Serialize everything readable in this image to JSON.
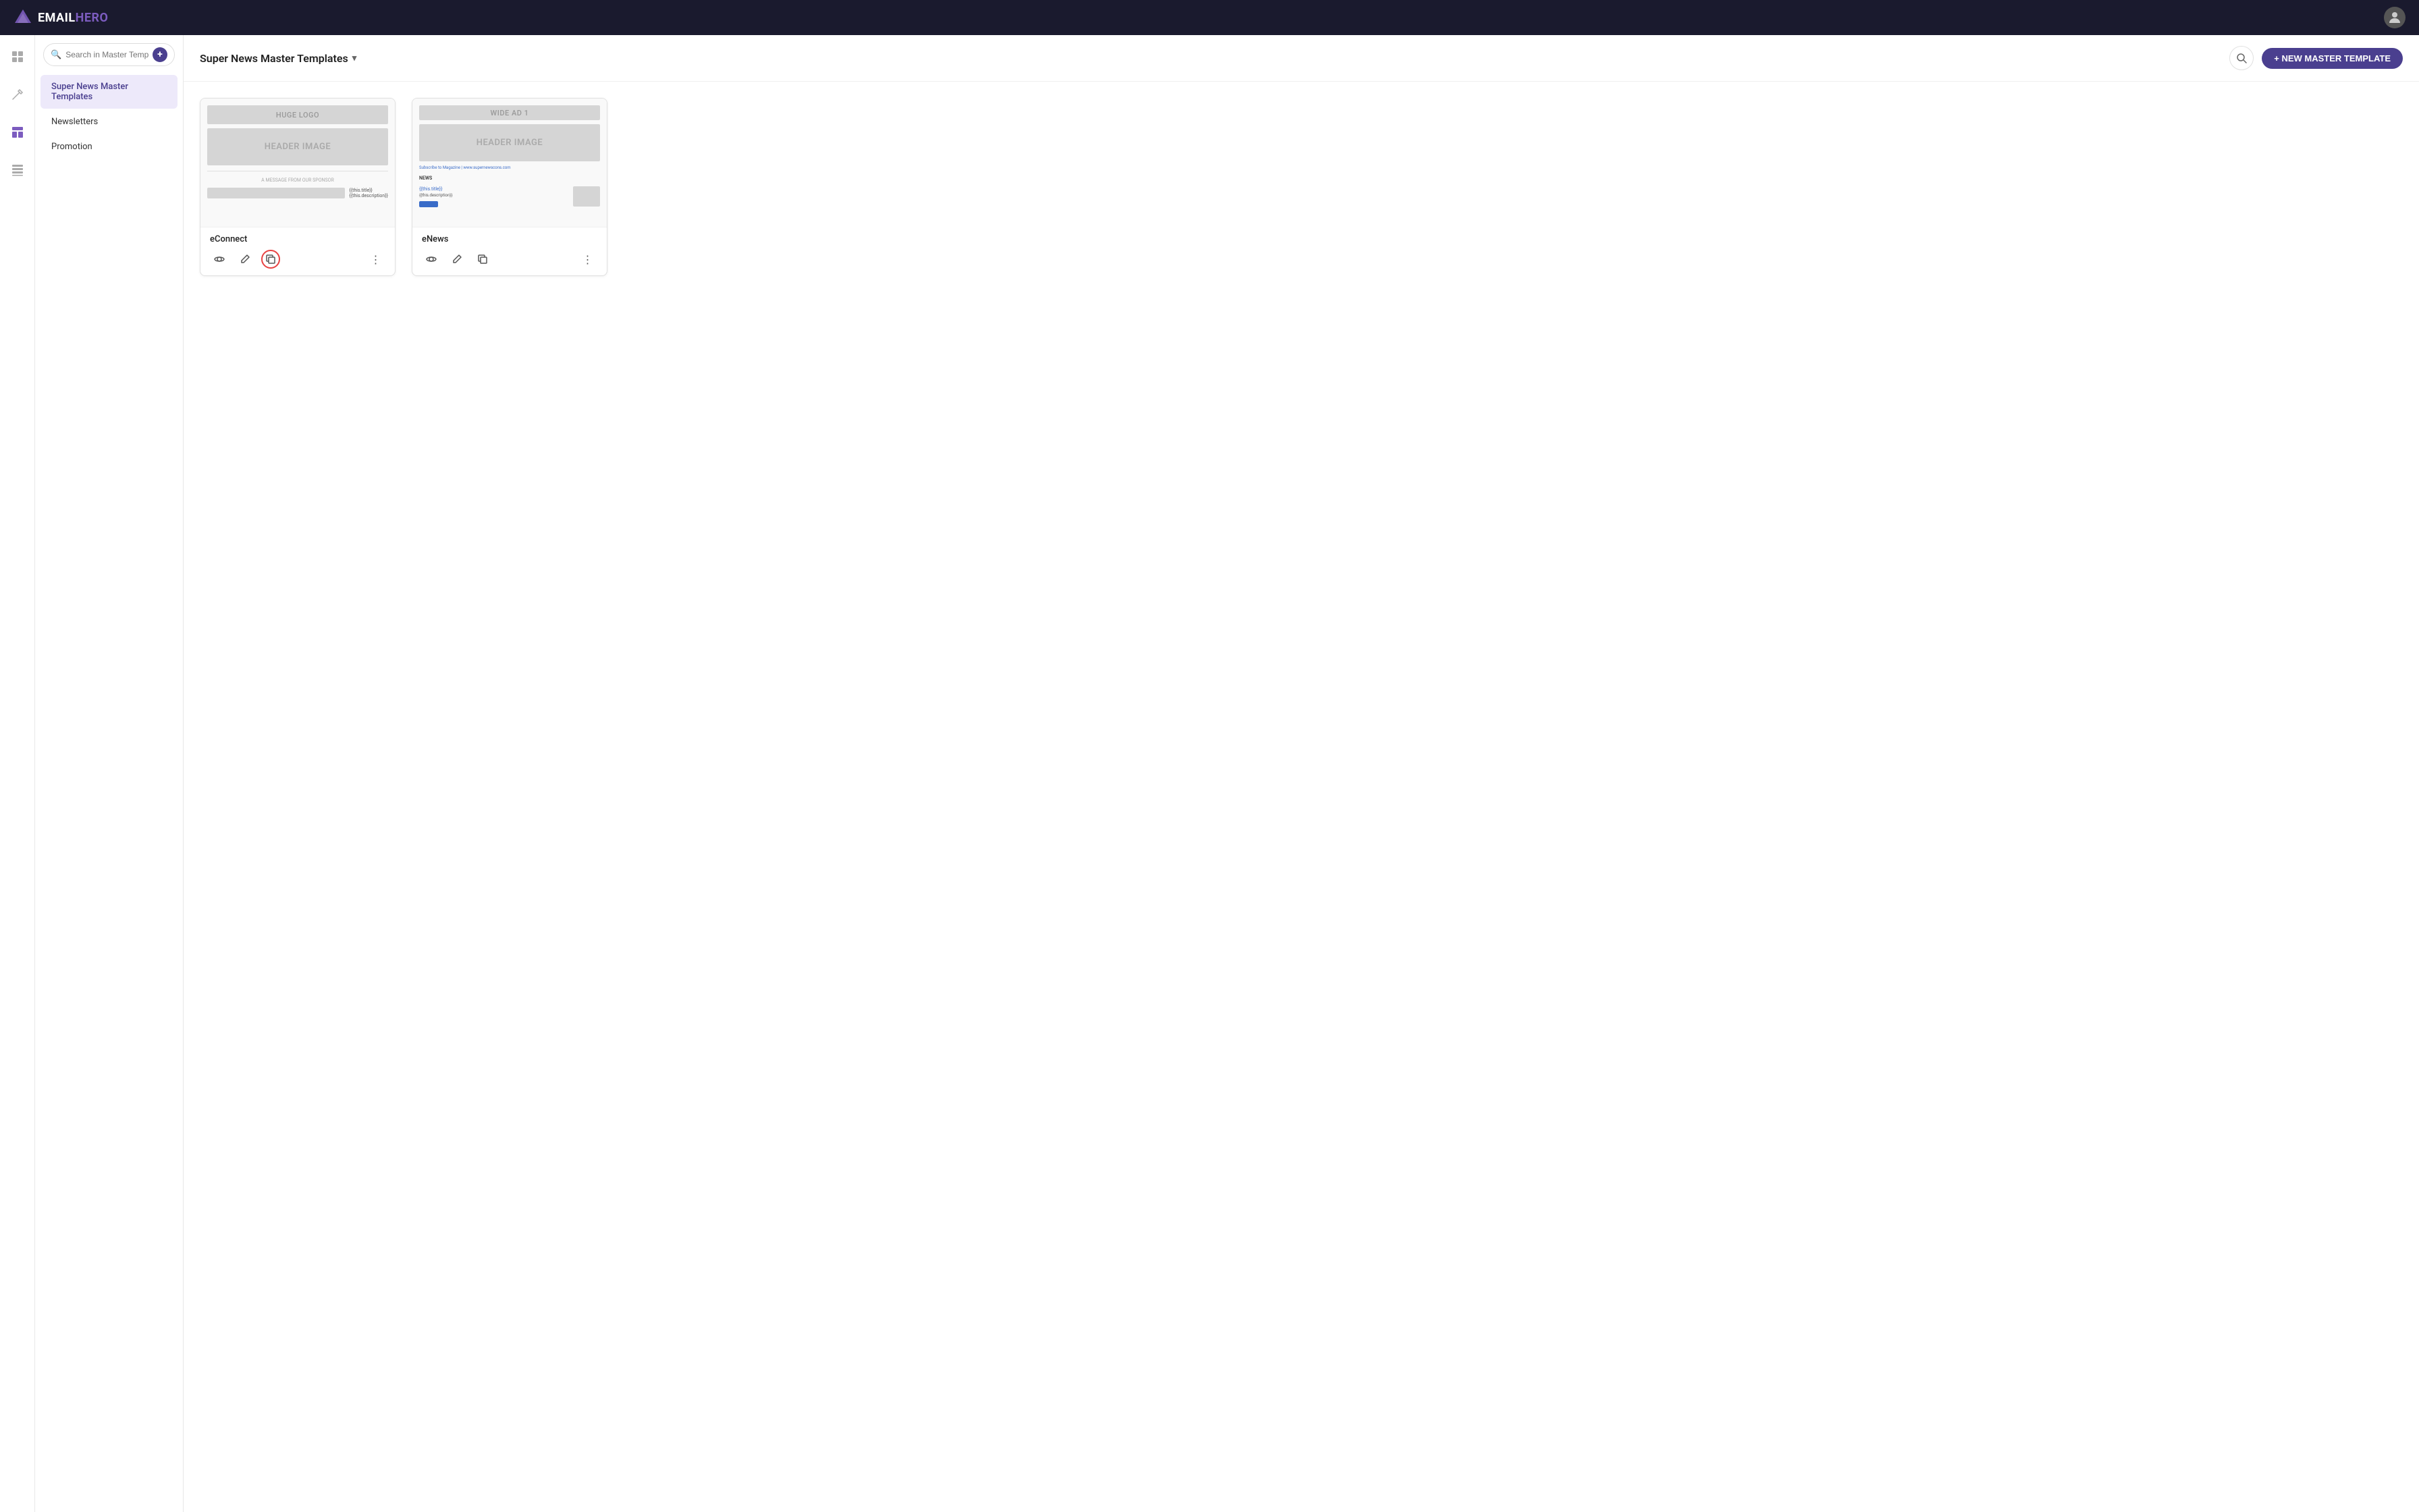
{
  "app": {
    "name_email": "EMAIL",
    "name_hero": "HERO",
    "user_icon": "account_circle"
  },
  "icon_sidebar": {
    "items": [
      {
        "name": "dashboard-icon",
        "symbol": "⊞",
        "active": false
      },
      {
        "name": "tools-icon",
        "symbol": "✦",
        "active": false
      },
      {
        "name": "templates-icon",
        "symbol": "▦",
        "active": true
      },
      {
        "name": "grid-icon",
        "symbol": "⊟",
        "active": false
      }
    ]
  },
  "sidebar": {
    "search_placeholder": "Search in Master Temp",
    "items": [
      {
        "label": "Super News Master Templates",
        "active": true
      },
      {
        "label": "Newsletters",
        "active": false
      },
      {
        "label": "Promotion",
        "active": false
      }
    ]
  },
  "header": {
    "title": "Super News Master Templates",
    "dropdown_aria": "dropdown",
    "new_button_label": "+ NEW MASTER TEMPLATE",
    "search_aria": "search"
  },
  "templates": [
    {
      "id": "econnect",
      "name": "eConnect",
      "preview": {
        "has_logo": true,
        "logo_label": "HUGE LOGO",
        "header_label": "HEADER IMAGE",
        "sponsor_text": "A MESSAGE FROM OUR SPONSOR",
        "has_title": true,
        "title_text": "{{this.title}}",
        "desc_text": "{{this.description}}"
      },
      "actions": {
        "view": true,
        "edit": true,
        "copy": true,
        "copy_active": true
      }
    },
    {
      "id": "enews",
      "name": "eNews",
      "preview": {
        "has_wide_ad": true,
        "wide_ad_label": "Wide AD 1",
        "header_label": "HEADER IMAGE",
        "subscribe_text": "Subscribe to Magazine | www.supernewscons.com",
        "news_label": "NEWS",
        "title_text": "{{this.title}}",
        "desc_text": "{{this.description}}",
        "has_cta": true
      },
      "actions": {
        "view": true,
        "edit": true,
        "copy": true,
        "copy_active": false
      }
    }
  ]
}
